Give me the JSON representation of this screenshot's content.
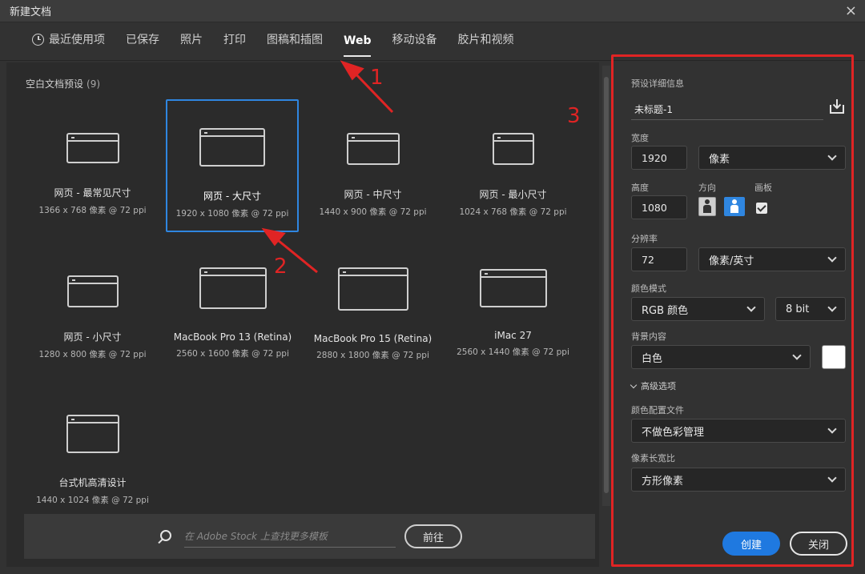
{
  "window": {
    "title": "新建文档",
    "close_glyph": "×"
  },
  "tabs": [
    {
      "label": "最近使用项",
      "icon": "clock-icon",
      "active": false
    },
    {
      "label": "已保存",
      "active": false
    },
    {
      "label": "照片",
      "active": false
    },
    {
      "label": "打印",
      "active": false
    },
    {
      "label": "图稿和插图",
      "active": false
    },
    {
      "label": "Web",
      "active": true
    },
    {
      "label": "移动设备",
      "active": false
    },
    {
      "label": "胶片和视频",
      "active": false
    }
  ],
  "presets_section": {
    "title": "空白文档预设",
    "count": "(9)"
  },
  "presets": [
    {
      "name": "网页 - 最常见尺寸",
      "dims": "1366 x 768 像素 @ 72 ppi",
      "selected": false
    },
    {
      "name": "网页 - 大尺寸",
      "dims": "1920 x 1080 像素 @ 72 ppi",
      "selected": true
    },
    {
      "name": "网页 - 中尺寸",
      "dims": "1440 x 900 像素 @ 72 ppi",
      "selected": false
    },
    {
      "name": "网页 - 最小尺寸",
      "dims": "1024 x 768 像素 @ 72 ppi",
      "selected": false
    },
    {
      "name": "网页 - 小尺寸",
      "dims": "1280 x 800 像素 @ 72 ppi",
      "selected": false
    },
    {
      "name": "MacBook Pro 13 (Retina)",
      "dims": "2560 x 1600 像素 @ 72 ppi",
      "selected": false
    },
    {
      "name": "MacBook Pro 15 (Retina)",
      "dims": "2880 x 1800 像素 @ 72 ppi",
      "selected": false
    },
    {
      "name": "iMac 27",
      "dims": "2560 x 1440 像素 @ 72 ppi",
      "selected": false
    },
    {
      "name": "台式机高清设计",
      "dims": "1440 x 1024 像素 @ 72 ppi",
      "selected": false
    }
  ],
  "stock": {
    "placeholder": "在 Adobe Stock 上查找更多模板",
    "go_label": "前往"
  },
  "details": {
    "title": "预设详细信息",
    "doc_name": "未标题-1",
    "width_label": "宽度",
    "width_value": "1920",
    "width_unit": "像素",
    "height_label": "高度",
    "height_value": "1080",
    "orientation_label": "方向",
    "artboard_label": "画板",
    "artboard_checked": true,
    "resolution_label": "分辨率",
    "resolution_value": "72",
    "resolution_unit": "像素/英寸",
    "color_mode_label": "颜色模式",
    "color_mode": "RGB 颜色",
    "bit_depth": "8 bit",
    "background_label": "背景内容",
    "background": "白色",
    "background_swatch": "#ffffff",
    "advanced_label": "高级选项",
    "color_profile_label": "颜色配置文件",
    "color_profile": "不做色彩管理",
    "pixel_aspect_label": "像素长宽比",
    "pixel_aspect": "方形像素",
    "create_label": "创建",
    "close_label": "关闭"
  },
  "annotations": {
    "n1": "1",
    "n2": "2",
    "n3": "3",
    "color": "#e02424"
  },
  "colors": {
    "accent": "#1f79e0",
    "selection": "#2f86e0"
  }
}
